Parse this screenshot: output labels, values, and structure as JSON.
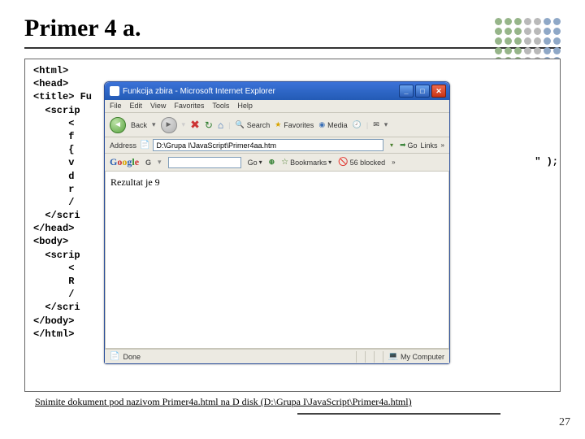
{
  "slide": {
    "title": "Primer 4 a.",
    "page_number": "27",
    "footnote": "Snimite dokument pod nazivom Primer4a.html na D disk (D:\\Grupa I\\JavaScript\\Primer4a.html)"
  },
  "code": {
    "lines": [
      "<html>",
      "<head>",
      "<title> Fu",
      "  <scrip",
      "      <",
      "      f",
      "      {",
      "      v",
      "      d",
      "      r",
      "      /",
      "  </scri",
      "</head>",
      "<body>",
      "  <scrip",
      "      <",
      "      R",
      "      /",
      "  </scri",
      "</body>",
      "</html>"
    ],
    "right_fragment": "\" );"
  },
  "ie": {
    "title": "Funkcija zbira - Microsoft Internet Explorer",
    "menu": [
      "File",
      "Edit",
      "View",
      "Favorites",
      "Tools",
      "Help"
    ],
    "toolbar": {
      "back": "Back",
      "search": "Search",
      "favorites": "Favorites",
      "media": "Media"
    },
    "address_label": "Address",
    "address_value": "D:\\Grupa I\\JavaScript\\Primer4aa.htm",
    "go": "Go",
    "links": "Links",
    "google": {
      "go": "Go",
      "bookmarks": "Bookmarks",
      "blocked": "56 blocked"
    },
    "content": "Rezultat je 9",
    "status": {
      "left": "Done",
      "right": "My Computer"
    }
  }
}
